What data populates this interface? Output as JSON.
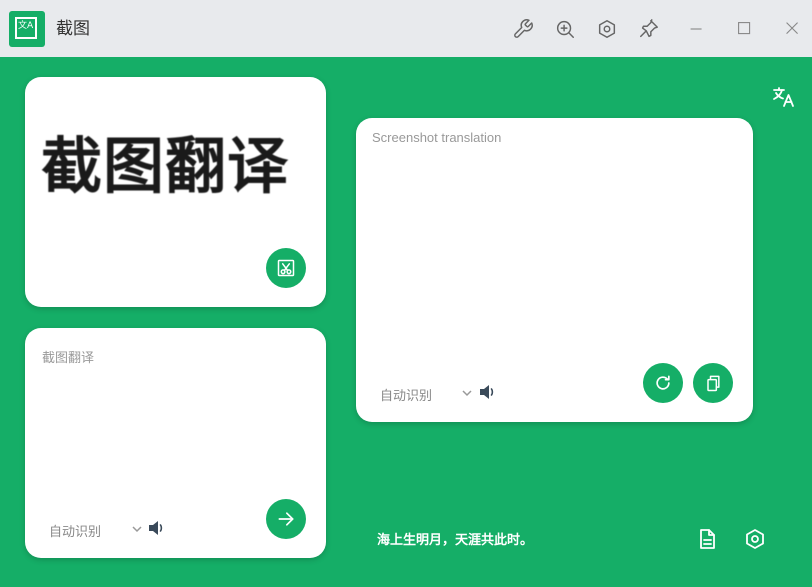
{
  "window": {
    "title": "截图",
    "logo_glyph": "文A"
  },
  "toolbar": {
    "icons": [
      "wrench-icon",
      "zoom-in-icon",
      "settings-icon",
      "pin-icon",
      "minimize-icon",
      "maximize-icon",
      "close-icon"
    ]
  },
  "image_card": {
    "captured_text": "截图翻译",
    "action_icon": "screenshot-scissors-icon"
  },
  "source_card": {
    "text": "截图翻译",
    "language": "自动识别",
    "action_icon": "arrow-right-icon"
  },
  "result_card": {
    "text": "Screenshot translation",
    "language": "自动识别",
    "actions": [
      "refresh-icon",
      "copy-icon"
    ]
  },
  "footer": {
    "quote": "海上生明月，天涯共此时。"
  },
  "colors": {
    "accent": "#15ae67",
    "titlebar": "#e8eaed"
  }
}
